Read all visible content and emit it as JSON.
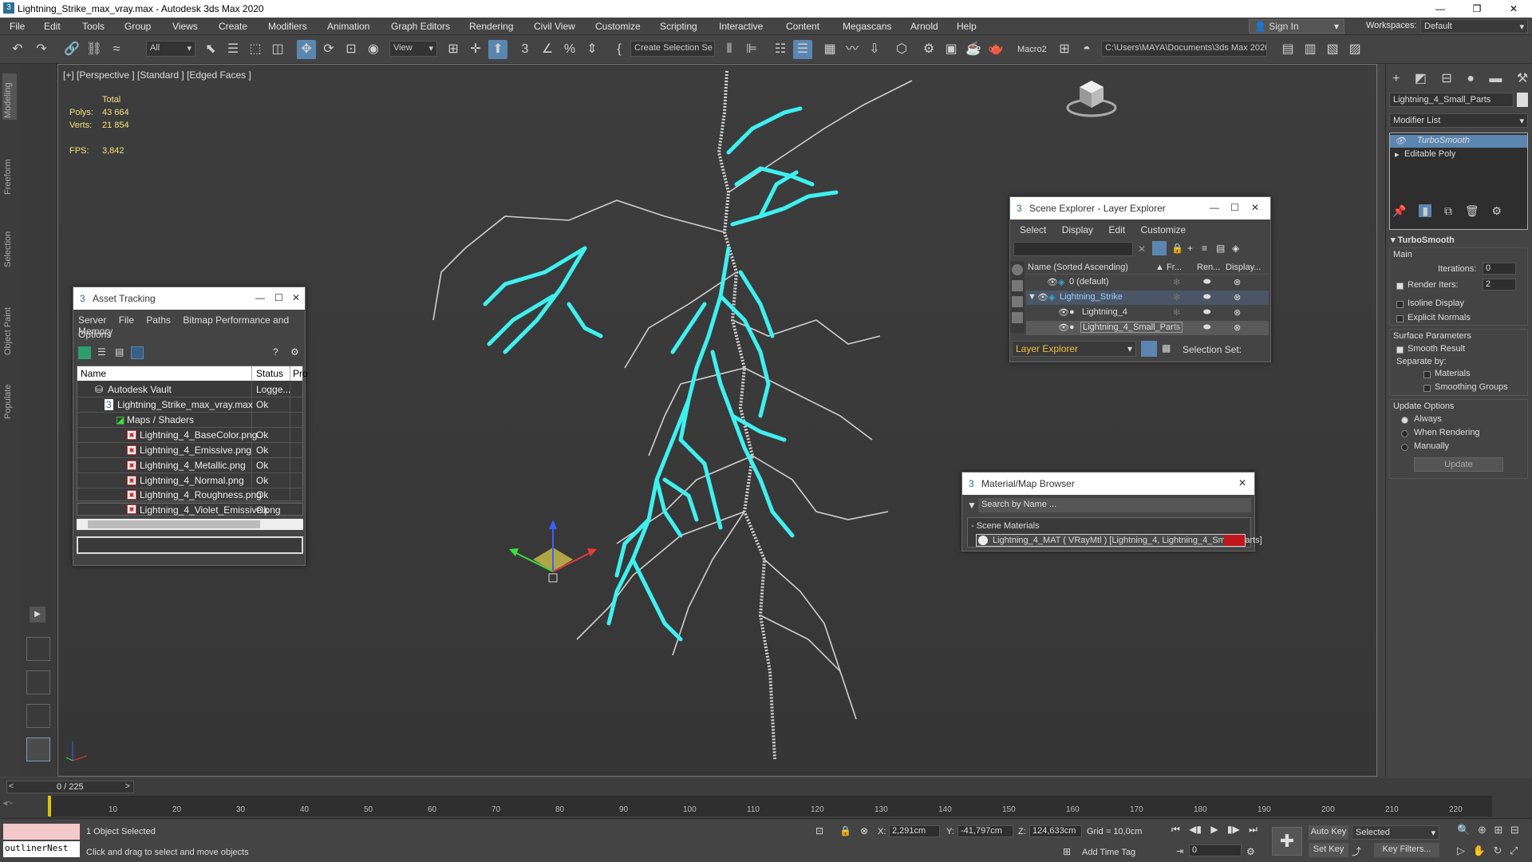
{
  "window": {
    "title": "Lightning_Strike_max_vray.max - Autodesk 3ds Max 2020"
  },
  "menu": [
    "File",
    "Edit",
    "Tools",
    "Group",
    "Views",
    "Create",
    "Modifiers",
    "Animation",
    "Graph Editors",
    "Rendering",
    "Civil View",
    "Customize",
    "Scripting",
    "Interactive",
    "Content",
    "Megascans",
    "Arnold",
    "Help"
  ],
  "account": {
    "sign_in": "Sign In",
    "workspaces_label": "Workspaces:",
    "workspace": "Default"
  },
  "toolbar": {
    "filter": "All",
    "view": "View",
    "selection_set": "Create Selection Se",
    "macro": "Macro2",
    "path": "C:\\Users\\MAYA\\Documents\\3ds Max 2020"
  },
  "left_tabs": [
    "Modeling",
    "Freeform",
    "Selection",
    "Object Paint",
    "Populate"
  ],
  "viewport": {
    "label": "[+] [Perspective ] [Standard ] [Edged Faces ]",
    "total_label": "Total",
    "polys_label": "Polys:",
    "polys": "43 664",
    "verts_label": "Verts:",
    "verts": "21 854",
    "fps_label": "FPS:",
    "fps": "3,842"
  },
  "asset_tracking": {
    "title": "Asset Tracking",
    "menu": [
      "Server",
      "File",
      "Paths",
      "Bitmap Performance and Memory",
      "Options"
    ],
    "columns": [
      "Name",
      "Status",
      "Pro"
    ],
    "rows": [
      {
        "name": "Autodesk Vault",
        "status": "Logge..."
      },
      {
        "name": "Lightning_Strike_max_vray.max",
        "status": "Ok"
      },
      {
        "name": "Maps / Shaders",
        "status": ""
      },
      {
        "name": "Lightning_4_BaseColor.png",
        "status": "Ok"
      },
      {
        "name": "Lightning_4_Emissive.png",
        "status": "Ok"
      },
      {
        "name": "Lightning_4_Metallic.png",
        "status": "Ok"
      },
      {
        "name": "Lightning_4_Normal.png",
        "status": "Ok"
      },
      {
        "name": "Lightning_4_Roughness.png",
        "status": "Ok"
      },
      {
        "name": "Lightning_4_Violet_Emissive.png",
        "status": "Ok"
      }
    ]
  },
  "scene_explorer": {
    "title": "Scene Explorer - Layer Explorer",
    "menu": [
      "Select",
      "Display",
      "Edit",
      "Customize"
    ],
    "columns": [
      "Name (Sorted Ascending)",
      "Fr...",
      "Ren...",
      "Display..."
    ],
    "rows": [
      {
        "name": "0 (default)"
      },
      {
        "name": "Lightning_Strike"
      },
      {
        "name": "Lightning_4"
      },
      {
        "name": "Lightning_4_Small_Parts"
      }
    ],
    "footer_dropdown": "Layer Explorer",
    "selection_set": "Selection Set:"
  },
  "material_browser": {
    "title": "Material/Map Browser",
    "search": "Search by Name ...",
    "group": "- Scene Materials",
    "material": "Lightning_4_MAT ( VRayMtl ) [Lightning_4, Lightning_4_Small_Parts]"
  },
  "command_panel": {
    "object_name": "Lightning_4_Small_Parts",
    "modifier_list": "Modifier List",
    "stack": [
      "TurboSmooth",
      "Editable Poly"
    ],
    "rollout": "TurboSmooth",
    "main": "Main",
    "iterations_label": "Iterations:",
    "iterations": "0",
    "render_iters_label": "Render Iters:",
    "render_iters": "2",
    "isoline": "Isoline Display",
    "explicit_normals": "Explicit Normals",
    "surface_params": "Surface Parameters",
    "smooth_result": "Smooth Result",
    "separate_by": "Separate by:",
    "materials": "Materials",
    "smoothing_groups": "Smoothing Groups",
    "update_options": "Update Options",
    "always": "Always",
    "when_rendering": "When Rendering",
    "manually": "Manually",
    "update_button": "Update"
  },
  "timeline": {
    "frame": "0 / 225",
    "ticks": [
      "0",
      "10",
      "20",
      "30",
      "40",
      "50",
      "60",
      "70",
      "80",
      "90",
      "100",
      "110",
      "120",
      "130",
      "140",
      "150",
      "160",
      "170",
      "180",
      "190",
      "200",
      "210",
      "220"
    ]
  },
  "status": {
    "script_box": "outlinerNest",
    "selected": "1 Object Selected",
    "prompt": "Click and drag to select and move objects",
    "x_label": "X:",
    "x": "2,291cm",
    "y_label": "Y:",
    "y": "-41,797cm",
    "z_label": "Z:",
    "z": "124,633cm",
    "grid": "Grid = 10,0cm",
    "add_time_tag": "Add Time Tag",
    "auto_key": "Auto Key",
    "set_key": "Set Key",
    "selected_dropdown": "Selected",
    "key_filters": "Key Filters...",
    "frame_input": "0"
  },
  "colors": {
    "lightning": "#3ff0f0",
    "accent": "#2a5d8c"
  }
}
